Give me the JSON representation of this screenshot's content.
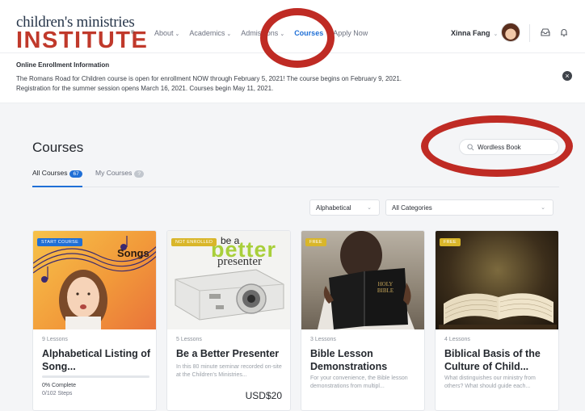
{
  "header": {
    "logo_top": "children's ministries",
    "logo_bottom": "INSTITUTE",
    "logo_reg": "®",
    "nav": [
      {
        "label": "About"
      },
      {
        "label": "Academics"
      },
      {
        "label": "Admissions"
      },
      {
        "label": "Courses",
        "active": true
      },
      {
        "label": "Apply Now"
      }
    ],
    "user_name": "Xinna Fang",
    "icons": [
      "avatar",
      "inbox-icon",
      "bell-icon"
    ]
  },
  "notice": {
    "title": "Online Enrollment Information",
    "line1": "The Romans Road for Children course is open for enrollment NOW through February 5, 2021! The course begins on February 9, 2021.",
    "line2": "Registration for the summer session opens March 16, 2021. Courses begin May 11, 2021."
  },
  "courses": {
    "title": "Courses",
    "search_value": "Wordless Book",
    "tabs": [
      {
        "label": "All Courses",
        "count": "67"
      },
      {
        "label": "My Courses",
        "count": "?"
      }
    ],
    "sort_value": "Alphabetical",
    "category_value": "All Categories",
    "cards": [
      {
        "badge": "START COURSE",
        "badge_color": "#1f6fd6",
        "lessons": "9 Lessons",
        "title": "Alphabetical Listing of Song...",
        "thumb_caption": "Songs",
        "progress": 0,
        "percent": "0% Complete",
        "steps": "0/102 Steps"
      },
      {
        "badge": "NOT ENROLLED",
        "badge_color": "#d9b62a",
        "lessons": "5 Lessons",
        "title": "Be a Better Presenter",
        "thumb_caption_a": "be a",
        "thumb_caption_b": "better",
        "thumb_caption_c": "presenter",
        "description": "In this 80 minute seminar recorded on-site at the Children's Ministries...",
        "price": "USD$20"
      },
      {
        "badge": "FREE",
        "badge_color": "#d9b62a",
        "lessons": "3 Lessons",
        "title": "Bible Lesson Demonstrations",
        "book_text": "HOLY BIBLE",
        "description": "For your convenience, the Bible lesson demonstrations from multipl..."
      },
      {
        "badge": "FREE",
        "badge_color": "#d9b62a",
        "lessons": "4 Lessons",
        "title": "Biblical Basis of the Culture of Child...",
        "description": "What distinguishes our ministry from others? What should guide each..."
      }
    ]
  },
  "colors": {
    "accent": "#1f6fd6",
    "annotation": "#bf2b24",
    "brand_red": "#c0392b"
  }
}
